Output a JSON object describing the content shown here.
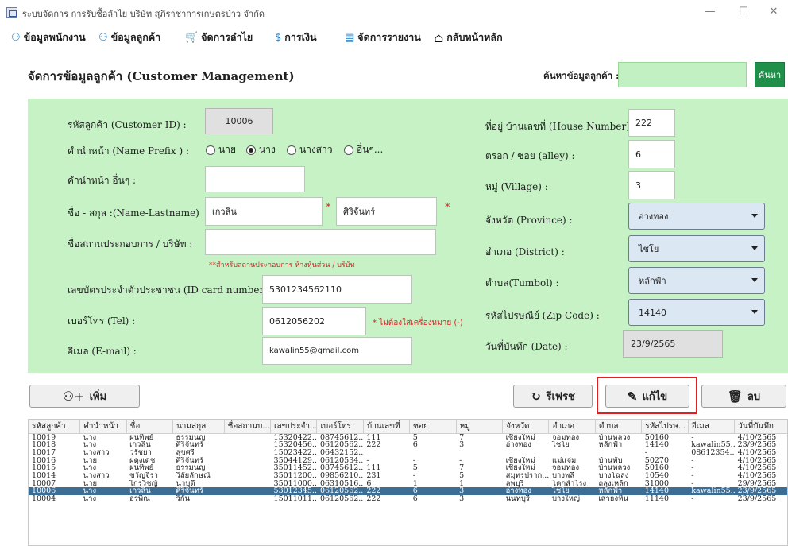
{
  "window": {
    "title": "ระบบจัดการ การรับซื้อลำไย บริษัท สุภิราชาการเกษตรป่าว จำกัด",
    "minimize": "—",
    "maximize": "☐",
    "close": "✕"
  },
  "menu": [
    {
      "icon": "⚇",
      "label": "ข้อมูลพนักงาน"
    },
    {
      "icon": "⚇",
      "label": "ข้อมูลลูกค้า"
    },
    {
      "icon": "🛒",
      "label": "จัดการลำไย"
    },
    {
      "icon": "$",
      "label": "การเงิน"
    },
    {
      "icon": "▤",
      "label": "จัดการรายงาน"
    },
    {
      "icon": "⌂",
      "label": "กลับหน้าหลัก"
    }
  ],
  "header": {
    "title": "จัดการข้อมูลลูกค้า (Customer Management)",
    "search_label": "ค้นหาข้อมูลลูกค้า :",
    "search_value": "",
    "search_button": "ค้นหา"
  },
  "form": {
    "customer_id_label": "รหัสลูกค้า (Customer ID) :",
    "customer_id": "10006",
    "prefix_label": "คำนำหน้า (Name Prefix ) :",
    "prefix_options": [
      "นาย",
      "นาง",
      "นางสาว",
      "อื่นๆ..."
    ],
    "prefix_selected": "นาง",
    "other_prefix_label": "คำนำหน้า อื่นๆ :",
    "other_prefix": "",
    "name_label": "ชื่อ - สกุล :(Name-Lastname)",
    "first_name": "เกวลิน",
    "last_name": "ศิริจันทร์",
    "required_mark": "*",
    "company_label": "ชื่อสถานประกอบการ / บริษัท :",
    "company": "",
    "company_note": "**สำหรับสถานประกอบการ ห้างหุ้นส่วน / บริษัท",
    "id_card_label": "เลขบัตรประจำตัวประชาชน (ID card number) :",
    "id_card": "5301234562110",
    "tel_label": "เบอร์โทร (Tel) :",
    "tel": "0612056202",
    "tel_note": "* ไม่ต้องใส่เครื่องหมาย (-)",
    "email_label": "อีเมล (E-mail) :",
    "email": "kawalin55@gmail.com",
    "house_label": "ที่อยู่ บ้านเลขที่ (House Number) :",
    "house": "222",
    "alley_label": "ตรอก / ซอย (alley) :",
    "alley": "6",
    "village_label": "หมู่ (Village) :",
    "village": "3",
    "province_label": "จังหวัด (Province) :",
    "province": "อ่างทอง",
    "district_label": "อำเภอ (District) :",
    "district": "ไชโย",
    "tumbol_label": "ตำบล(Tumbol) :",
    "tumbol": "หลักฟ้า",
    "zip_label": "รหัสไปรษณีย์ (Zip Code) :",
    "zip": "14140",
    "date_label": "วันที่บันทึก (Date) :",
    "date": "23/9/2565"
  },
  "actions": {
    "add": "เพิ่ม",
    "refresh": "รีเฟรช",
    "edit": "แก้ไข",
    "delete": "ลบ"
  },
  "table": {
    "columns": [
      "รหัสลูกค้า",
      "คำนำหน้า",
      "ชื่อ",
      "นามสกุล",
      "ชื่อสถานบ...",
      "เลขประจำ...",
      "เบอร์โทร",
      "บ้านเลขที่",
      "ซอย",
      "หมู่",
      "จังหวัด",
      "อำเภอ",
      "ตำบล",
      "รหัสไปรษ...",
      "อีเมล",
      "วันที่บันทึก"
    ],
    "rows": [
      [
        "10019",
        "นาง",
        "ฝนทิพย์",
        "ธรรมนญ",
        "",
        "15320422...",
        "08745612...",
        "111",
        "5",
        "7",
        "เชียงใหม่",
        "จอมทอง",
        "บ้านหลวง",
        "50160",
        "-",
        "4/10/2565"
      ],
      [
        "10018",
        "นาง",
        "เกวลิน",
        "ศิริจันทร์",
        "",
        "15320456...",
        "06120562...",
        "222",
        "6",
        "3",
        "อ่างทอง",
        "ไชโย",
        "หลักฟ้า",
        "14140",
        "kawalin55...",
        "23/9/2565"
      ],
      [
        "10017",
        "นางสาว",
        "วรัชยา",
        "สุขศรี",
        "",
        "15023422...",
        "06432152...",
        "",
        "",
        "",
        "",
        "",
        "",
        "-",
        "08612354...",
        "4/10/2565"
      ],
      [
        "10016",
        "นาย",
        "ผดุงเดช",
        "ศิริจันทร์",
        "",
        "35044129...",
        "06120534...",
        "-",
        "-",
        "-",
        "เชียงใหม่",
        "แม่แจ่ม",
        "บ้านทับ",
        "50270",
        "-",
        "4/10/2565"
      ],
      [
        "10015",
        "นาง",
        "ฝนทิพย์",
        "ธรรมนญ",
        "",
        "35011452...",
        "08745612...",
        "111",
        "5",
        "7",
        "เชียงใหม่",
        "จอมทอง",
        "บ้านหลวง",
        "50160",
        "-",
        "4/10/2565"
      ],
      [
        "10014",
        "นางสาว",
        "ขวัญจิรา",
        "วิลัยลักษณ์",
        "",
        "35011200...",
        "09856210...",
        "231",
        "-",
        "5",
        "สมุทรปราก...",
        "บางพลี",
        "บางโฉลง",
        "10540",
        "-",
        "4/10/2565"
      ],
      [
        "10007",
        "นาย",
        "ไกรวิชญ์",
        "นาบุดี",
        "",
        "35011000...",
        "06310516...",
        "6",
        "1",
        "1",
        "ลพบุรี",
        "โคกสำโรง",
        "ถลุงเหล็ก",
        "31000",
        "-",
        "29/9/2565"
      ],
      [
        "10006",
        "นาง",
        "เกวลิน",
        "ศิริจันทร์",
        "",
        "53012345...",
        "06120562...",
        "222",
        "6",
        "3",
        "อ่างทอง",
        "ไชโย",
        "หลักฟ้า",
        "14140",
        "kawalin55...",
        "23/9/2565"
      ],
      [
        "10004",
        "นาง",
        "อรพิณ",
        "วิกัน",
        "",
        "15011011...",
        "06120562...",
        "222",
        "6",
        "3",
        "นนทบุรี",
        "บางใหญ่",
        "เสาธงหิน",
        "11140",
        "-",
        "23/9/2565"
      ]
    ],
    "selected_row_index": 7
  }
}
